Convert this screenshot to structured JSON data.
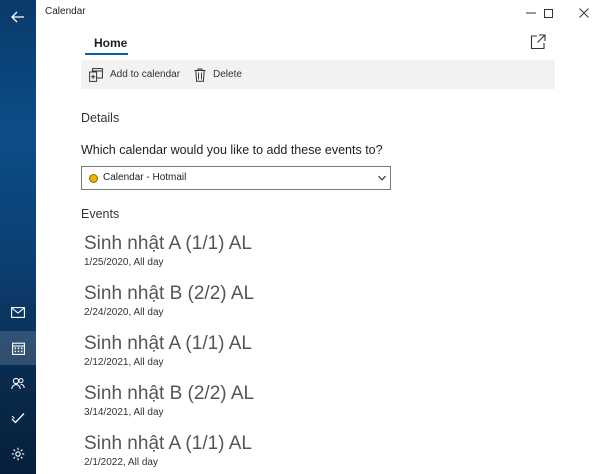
{
  "window": {
    "title": "Calendar"
  },
  "header": {
    "tab_home": "Home"
  },
  "toolbar": {
    "add_label": "Add to calendar",
    "delete_label": "Delete"
  },
  "details": {
    "heading": "Details",
    "question": "Which calendar would you like to add these events to?",
    "selected_calendar": "Calendar - Hotmail",
    "calendar_color": "#e6b800"
  },
  "events": {
    "heading": "Events",
    "items": [
      {
        "title": "Sinh nhật A (1/1) AL",
        "when": "1/25/2020, All day"
      },
      {
        "title": "Sinh nhật B (2/2) AL",
        "when": "2/24/2020, All day"
      },
      {
        "title": "Sinh nhật A (1/1) AL",
        "when": "2/12/2021, All day"
      },
      {
        "title": "Sinh nhật B (2/2) AL",
        "when": "3/14/2021, All day"
      },
      {
        "title": "Sinh nhật A (1/1) AL",
        "when": "2/1/2022, All day"
      }
    ]
  },
  "rail": {
    "icons": [
      "back-arrow-icon",
      "mail-icon",
      "calendar-icon",
      "people-icon",
      "todo-icon",
      "settings-icon"
    ],
    "active": "calendar-icon",
    "accent": "#0063b1"
  }
}
